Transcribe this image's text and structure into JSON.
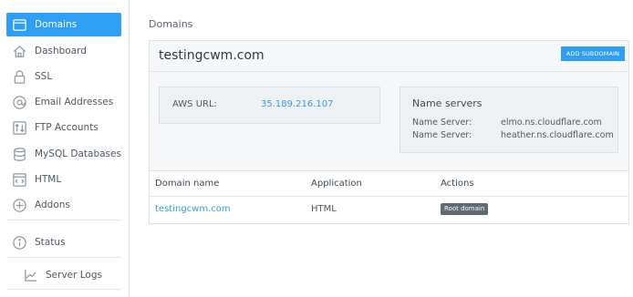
{
  "sidebar": {
    "items": [
      {
        "label": "Domains",
        "icon": "browser-window-icon",
        "active": true
      },
      {
        "label": "Dashboard",
        "icon": "house-icon"
      },
      {
        "label": "SSL",
        "icon": "lock-icon"
      },
      {
        "label": "Email Addresses",
        "icon": "at-sign-icon"
      },
      {
        "label": "FTP Accounts",
        "icon": "ftp-transfer-icon"
      },
      {
        "label": "MySQL Databases",
        "icon": "database-icon"
      },
      {
        "label": "HTML",
        "icon": "html-file-icon"
      },
      {
        "label": "Addons",
        "icon": "plus-circle-icon"
      },
      {
        "label": "Status",
        "icon": "info-circle-icon"
      },
      {
        "label": "Server Logs",
        "icon": "chart-line-icon"
      }
    ]
  },
  "breadcrumb": "Domains",
  "domain": {
    "title": "testingcwm.com",
    "add_subdomain_label": "ADD SUBDOMAIN",
    "aws_label": "AWS URL:",
    "aws_value": "35.189.216.107",
    "ns_title": "Name servers",
    "name_servers": [
      {
        "key": "Name Server:",
        "value": "elmo.ns.cloudflare.com"
      },
      {
        "key": "Name Server:",
        "value": "heather.ns.cloudflare.com"
      }
    ]
  },
  "table": {
    "headers": [
      "Domain name",
      "Application",
      "Actions"
    ],
    "rows": [
      {
        "domain": "testingcwm.com",
        "application": "HTML",
        "action": "Root domain"
      }
    ]
  },
  "colors": {
    "accent": "#2e9ff3",
    "link": "#3a9be0",
    "badge": "#5f6a73"
  }
}
